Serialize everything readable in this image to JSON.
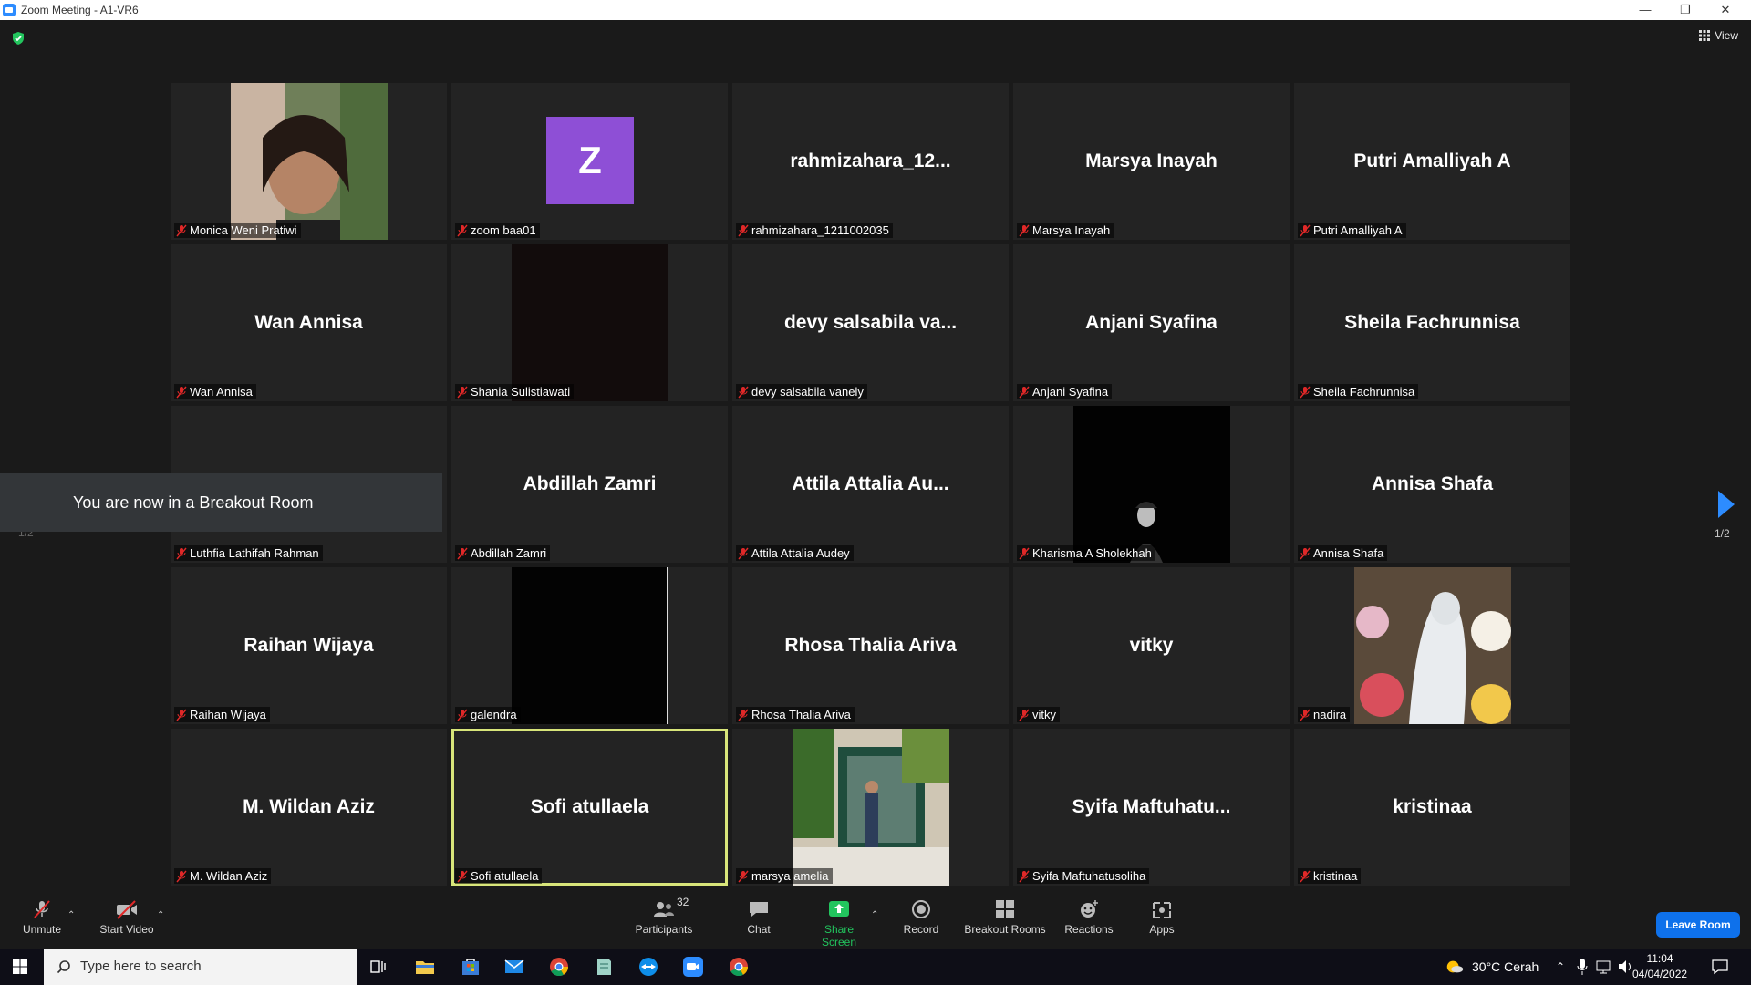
{
  "window": {
    "title": "Zoom Meeting - A1-VR6",
    "minimize": "—",
    "restore": "❐",
    "close": "✕"
  },
  "header": {
    "view_label": "View"
  },
  "participants_tiles": [
    {
      "name": "Monica Weni Pratiwi",
      "big": "",
      "type": "video",
      "video": "woman-selfie"
    },
    {
      "name": "zoom baa01",
      "big": "",
      "type": "avatar",
      "initial": "Z"
    },
    {
      "name": "rahmizahara_1211002035",
      "big": "rahmizahara_12...",
      "type": "name"
    },
    {
      "name": "Marsya Inayah",
      "big": "Marsya Inayah",
      "type": "name"
    },
    {
      "name": "Putri Amalliyah A",
      "big": "Putri Amalliyah A",
      "type": "name"
    },
    {
      "name": "Wan Annisa",
      "big": "Wan Annisa",
      "type": "name"
    },
    {
      "name": "Shania Sulistiawati",
      "big": "",
      "type": "video",
      "video": "dark"
    },
    {
      "name": "devy salsabila vanely",
      "big": "devy salsabila va...",
      "type": "name"
    },
    {
      "name": "Anjani Syafina",
      "big": "Anjani Syafina",
      "type": "name"
    },
    {
      "name": "Sheila Fachrunnisa",
      "big": "Sheila Fachrunnisa",
      "type": "name"
    },
    {
      "name": "Luthfia Lathifah Rahman",
      "big": "Luthfia  Lathifah...",
      "type": "name"
    },
    {
      "name": "Abdillah Zamri",
      "big": "Abdillah Zamri",
      "type": "name"
    },
    {
      "name": "Attila Attalia Audey",
      "big": "Attila Attalia Au...",
      "type": "name"
    },
    {
      "name": "Kharisma A Sholekhah",
      "big": "",
      "type": "video",
      "video": "man-portrait"
    },
    {
      "name": "Annisa Shafa",
      "big": "Annisa Shafa",
      "type": "name"
    },
    {
      "name": "Raihan Wijaya",
      "big": "Raihan Wijaya",
      "type": "name"
    },
    {
      "name": "galendra",
      "big": "",
      "type": "video",
      "video": "black"
    },
    {
      "name": "Rhosa Thalia Ariva",
      "big": "Rhosa Thalia Ariva",
      "type": "name"
    },
    {
      "name": "vitky",
      "big": "vitky",
      "type": "name"
    },
    {
      "name": "nadira",
      "big": "",
      "type": "video",
      "video": "flowers"
    },
    {
      "name": "M. Wildan Aziz",
      "big": "M. Wildan Aziz",
      "type": "name"
    },
    {
      "name": "Sofi atullaela",
      "big": "Sofi atullaela",
      "type": "name",
      "active": true
    },
    {
      "name": "marsya amelia",
      "big": "",
      "type": "video",
      "video": "street"
    },
    {
      "name": "Syifa Maftuhatusoliha",
      "big": "Syifa  Maftuhatu...",
      "type": "name"
    },
    {
      "name": "kristinaa",
      "big": "kristinaa",
      "type": "name"
    }
  ],
  "breakout": {
    "message": "You are now in a Breakout Room"
  },
  "pagination": {
    "left": "1/2",
    "right": "1/2"
  },
  "toolbar": {
    "unmute": "Unmute",
    "start_video": "Start Video",
    "participants": "Participants",
    "participants_count": "32",
    "chat": "Chat",
    "share_screen": "Share Screen",
    "record": "Record",
    "breakout_rooms": "Breakout Rooms",
    "reactions": "Reactions",
    "apps": "Apps",
    "leave_room": "Leave Room"
  },
  "taskbar": {
    "search_placeholder": "Type here to search",
    "weather": "30°C  Cerah",
    "time": "11:04",
    "date": "04/04/2022"
  },
  "colors": {
    "accent": "#2d8cff",
    "active_speaker": "#d8e57a",
    "share_green": "#22c55e",
    "leave_blue": "#0e71eb",
    "muted_red": "#e02828"
  }
}
